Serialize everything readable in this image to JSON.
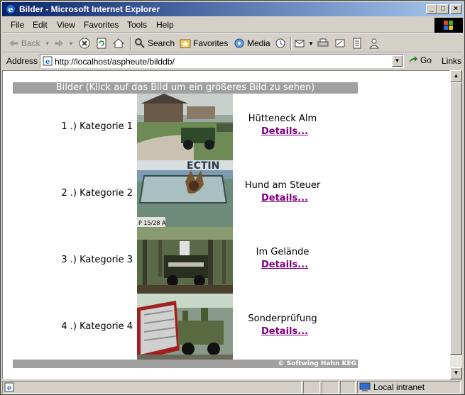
{
  "window": {
    "title": "Bilder - Microsoft Internet Explorer",
    "minimize": "_",
    "maximize": "□",
    "close": "×"
  },
  "menu": [
    "File",
    "Edit",
    "View",
    "Favorites",
    "Tools",
    "Help"
  ],
  "toolbar": {
    "back": "Back",
    "search": "Search",
    "favorites": "Favorites",
    "media": "Media"
  },
  "address": {
    "label": "Address",
    "url": "http://localhost/aspheute/bilddb/",
    "go": "Go",
    "links": "Links"
  },
  "page": {
    "header": "Bilder (Klick auf das Bild um ein größeres Bild zu sehen)",
    "footer": "© Softwing Hahn KEG",
    "rows": [
      {
        "category": "1 .)  Kategorie 1",
        "caption": "Hütteneck Alm",
        "details": "Details..."
      },
      {
        "category": "2 .)  Kategorie 2",
        "caption": "Hund am Steuer",
        "details": "Details..."
      },
      {
        "category": "3 .)  Kategorie 3",
        "caption": "Im Gelände",
        "details": "Details..."
      },
      {
        "category": "4 .)  Kategorie 4",
        "caption": "Sonderprüfung",
        "details": "Details..."
      }
    ]
  },
  "status": {
    "zone": "Local intranet"
  },
  "colors": {
    "titlebar_start": "#0a246a",
    "header_bar": "#a0a0a0",
    "details_link": "#800080"
  }
}
